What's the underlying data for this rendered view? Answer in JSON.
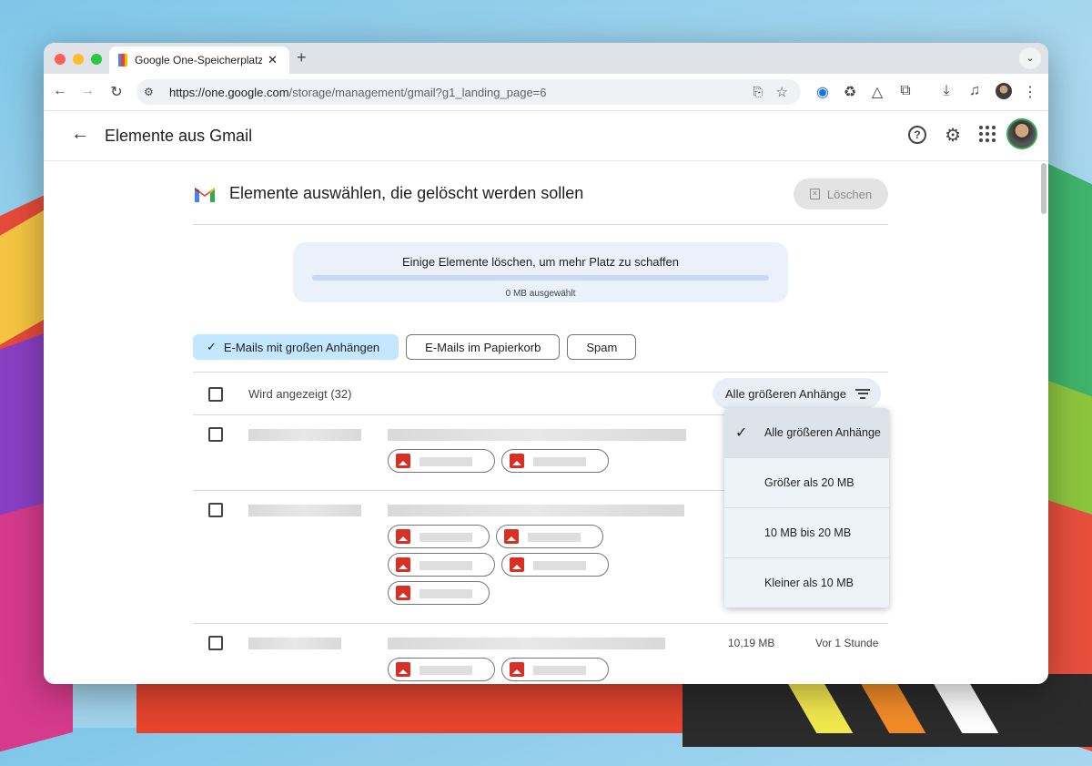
{
  "browser": {
    "tab_title": "Google One-Speicherplatzverwaltung",
    "tab_close": "✕",
    "new_tab": "+",
    "url_host": "https://one.google.com",
    "url_path": "/storage/management/gmail?g1_landing_page=6"
  },
  "appbar": {
    "title": "Elemente aus Gmail"
  },
  "header": {
    "title": "Elemente auswählen, die gelöscht werden sollen",
    "delete_label": "Löschen"
  },
  "storage": {
    "title": "Einige Elemente löschen, um mehr Platz zu schaffen",
    "selected": "0 MB ausgewählt",
    "progress_percent": 0
  },
  "chips": {
    "large_attachments": "E-Mails mit großen Anhängen",
    "trash": "E-Mails im Papierkorb",
    "spam": "Spam"
  },
  "list": {
    "showing": "Wird angezeigt (32)",
    "filter_label": "Alle größeren Anhänge",
    "rows": [
      {
        "size": "",
        "time": ""
      },
      {
        "size": "",
        "time": ""
      },
      {
        "size": "10,19 MB",
        "time": "Vor 1 Stunde"
      }
    ]
  },
  "menu": {
    "items": [
      {
        "label": "Alle größeren Anhänge",
        "selected": true
      },
      {
        "label": "Größer als 20 MB",
        "selected": false
      },
      {
        "label": "10 MB bis 20 MB",
        "selected": false
      },
      {
        "label": "Kleiner als 10 MB",
        "selected": false
      }
    ],
    "check": "✓"
  },
  "colors": {
    "accent": "#0b57d0",
    "chip_active": "#c2e7ff",
    "attachment_icon": "#d93025"
  },
  "icons": [
    "back-arrow-icon",
    "forward-arrow-icon",
    "reload-icon",
    "tune-icon",
    "install-icon",
    "star-icon",
    "password-icon",
    "recycle-icon",
    "drive-icon",
    "extensions-icon",
    "download-icon",
    "media-icon",
    "more-icon",
    "help-icon",
    "gear-icon",
    "apps-icon",
    "gmail-logo",
    "trash-icon",
    "check-icon",
    "filter-icon",
    "image-icon"
  ]
}
